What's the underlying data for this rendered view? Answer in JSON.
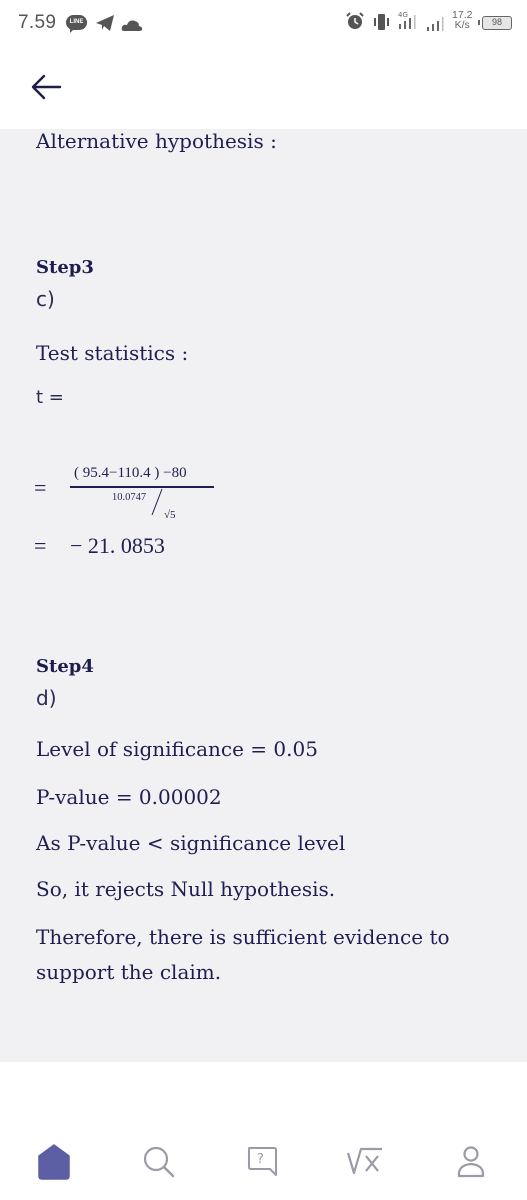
{
  "status_bar": {
    "time": "7.59",
    "line_badge": "LINE",
    "network_type": "4G",
    "net_speed_value": "17.2",
    "net_speed_unit": "K/s",
    "battery": "98"
  },
  "header": {
    "back_icon": "arrow-left-icon"
  },
  "content": {
    "alt_hypothesis_label": "Alternative hypothesis :",
    "step3": {
      "title": "Step3",
      "part": "c)",
      "test_stat_label": "Test statistics :",
      "t_label": "t =",
      "equals": "=",
      "numerator": "( 95.4−110.4 ) −80",
      "denominator_sd": "10.0747",
      "denominator_sqrt": "√5",
      "result": "− 21. 0853"
    },
    "step4": {
      "title": "Step4",
      "part": "d)",
      "significance": "Level of significance = 0.05",
      "p_value": "P-value = 0.00002",
      "comparison": "As P-value < significance level",
      "decision": "So, it rejects Null hypothesis.",
      "conclusion_line1": "Therefore, there is sufficient evidence to",
      "conclusion_line2": "support the claim."
    }
  },
  "bottom_nav": {
    "items": [
      {
        "name": "home",
        "icon": "home-icon",
        "active": true
      },
      {
        "name": "search",
        "icon": "search-icon",
        "active": false
      },
      {
        "name": "ask-question",
        "icon": "question-bubble-icon",
        "active": false
      },
      {
        "name": "math-solver",
        "icon": "square-root-icon",
        "active": false
      },
      {
        "name": "profile",
        "icon": "user-icon",
        "active": false
      }
    ],
    "active_color": "#5c5fa3",
    "inactive_color": "#9a9aa8"
  }
}
